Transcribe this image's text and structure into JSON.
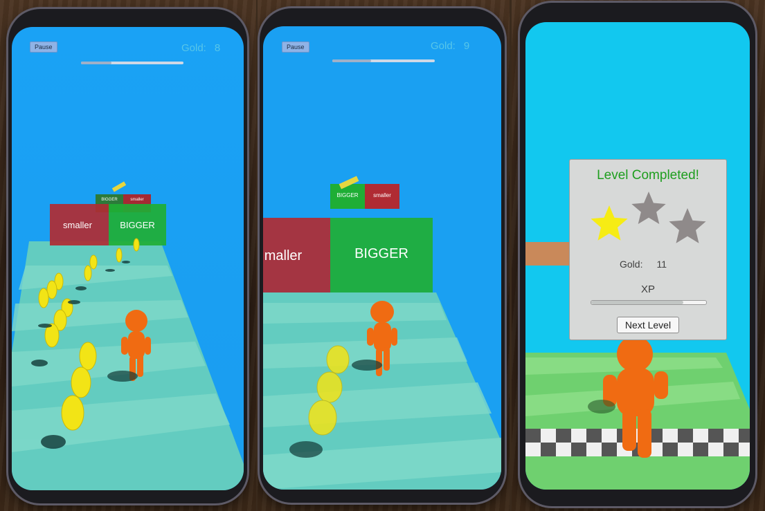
{
  "screens": [
    {
      "hud": {
        "pause_label": "Pause",
        "gold_label": "Gold:",
        "gold_value": "8",
        "level_progress": 0.3
      },
      "gate": {
        "left_label": "smaller",
        "right_label": "BIGGER"
      },
      "far_gate": {
        "left_label": "BIGGER",
        "right_label": "smaller"
      }
    },
    {
      "hud": {
        "pause_label": "Pause",
        "gold_label": "Gold:",
        "gold_value": "9",
        "level_progress": 0.38
      },
      "gate": {
        "left_label": "maller",
        "right_label": "BIGGER"
      },
      "far_gate": {
        "left_label": "BIGGER",
        "right_label": "smaller"
      }
    },
    {
      "completion": {
        "title": "Level Completed!",
        "stars_earned": 1,
        "stars_total": 3,
        "gold_label": "Gold:",
        "gold_value": "11",
        "xp_label": "XP",
        "xp_progress": 0.8,
        "next_button_label": "Next Level"
      }
    }
  ],
  "colors": {
    "sky": "#1aa2f5",
    "track": "#63ccc0",
    "gate_green": "#1fae35",
    "gate_red": "#b02b33",
    "coin": "#f2e416",
    "runner": "#f06b12",
    "title_green": "#1e9e1e",
    "star_gold": "#f6ec14",
    "star_grey": "#8f8a8a"
  }
}
